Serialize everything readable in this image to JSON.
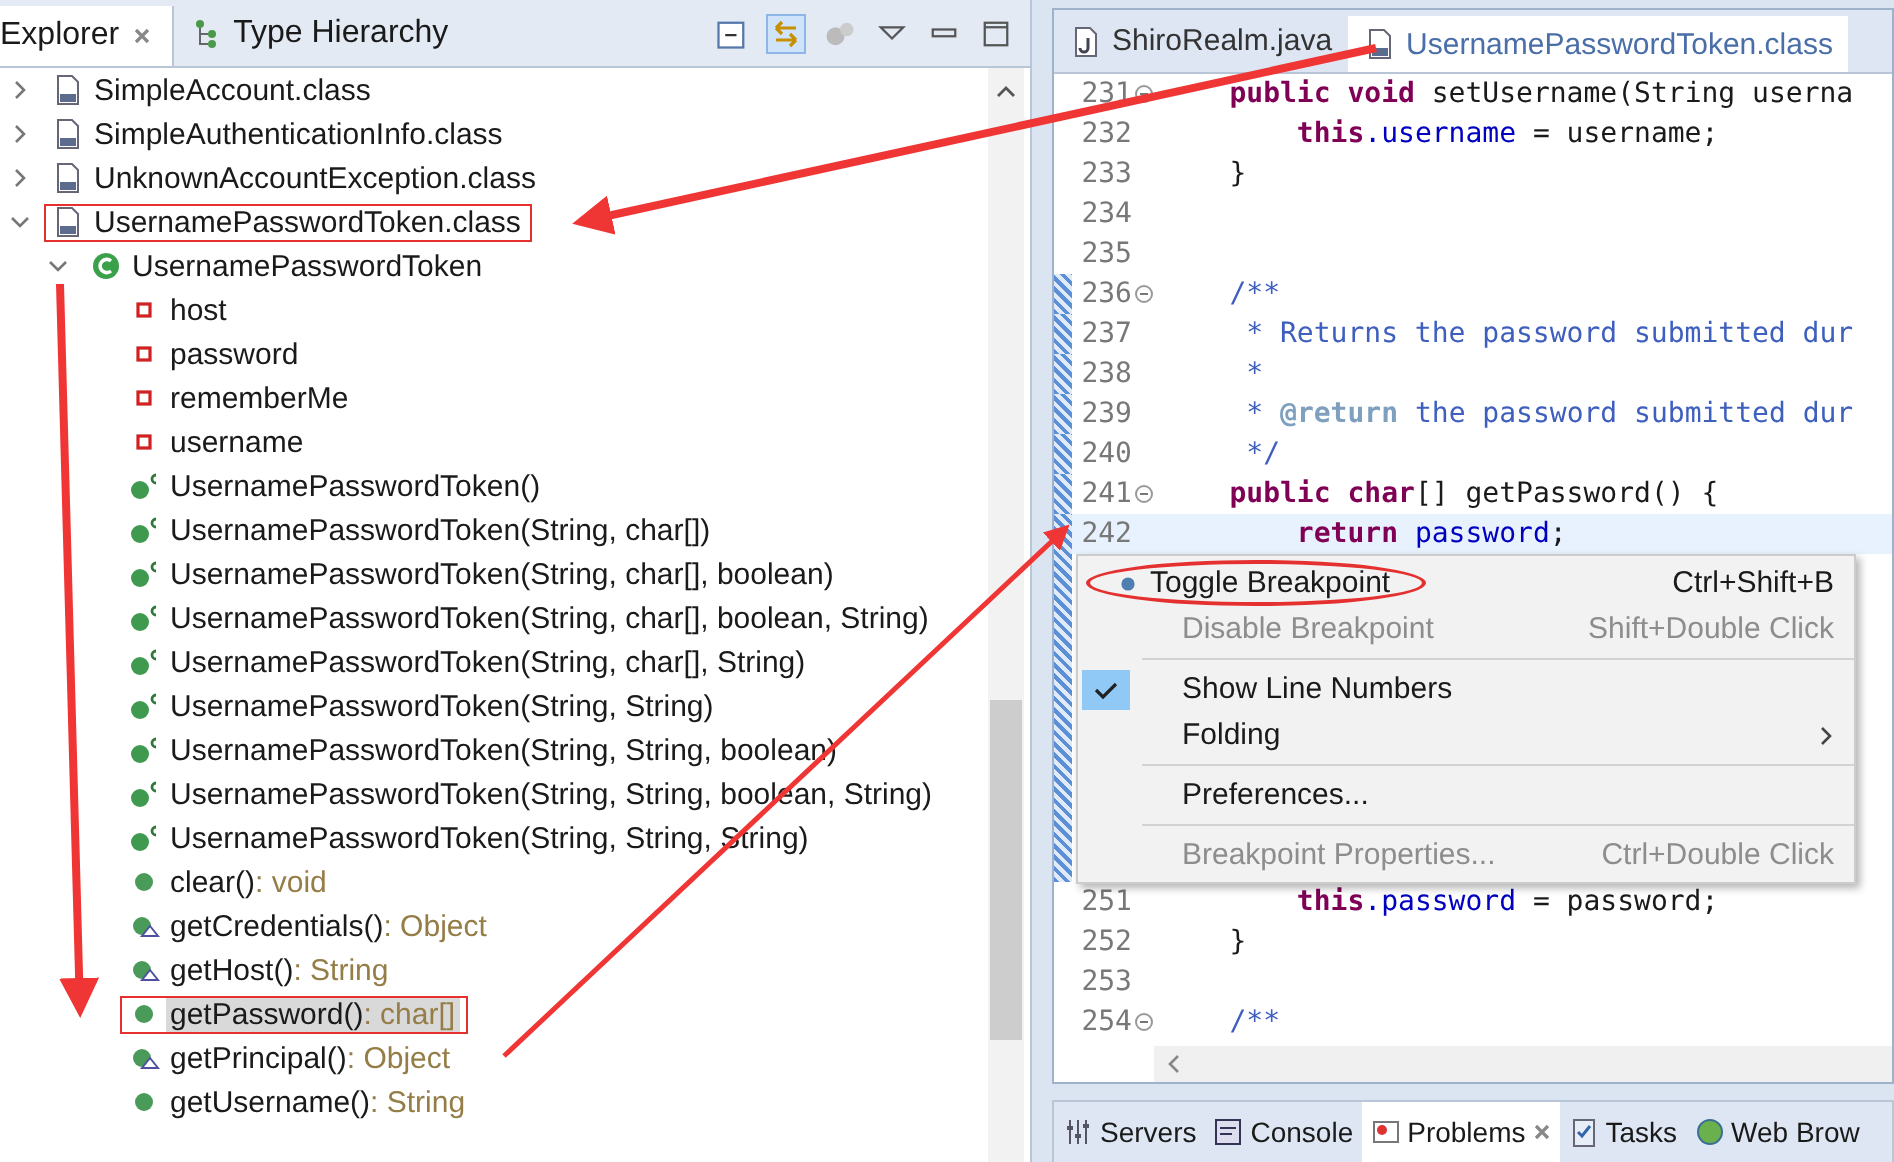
{
  "explorer": {
    "tabs": [
      {
        "label": "Explorer",
        "selected": true
      },
      {
        "label": "Type Hierarchy",
        "selected": false
      }
    ],
    "tree": [
      {
        "label": "SimpleAccount.class",
        "kind": "class-file",
        "expanded": false,
        "selected": false,
        "framed": false
      },
      {
        "label": "SimpleAuthenticationInfo.class",
        "kind": "class-file",
        "expanded": false,
        "selected": false,
        "framed": false
      },
      {
        "label": "UnknownAccountException.class",
        "kind": "class-file",
        "expanded": false,
        "selected": false,
        "framed": false
      },
      {
        "label": "UsernamePasswordToken.class",
        "kind": "class-file",
        "expanded": true,
        "selected": false,
        "framed": true,
        "children": [
          {
            "label": "UsernamePasswordToken",
            "kind": "class",
            "expanded": true,
            "selected": false,
            "framed": false,
            "children": [
              {
                "label": "host",
                "kind": "field",
                "selected": false,
                "framed": false
              },
              {
                "label": "password",
                "kind": "field",
                "selected": false,
                "framed": false
              },
              {
                "label": "rememberMe",
                "kind": "field",
                "selected": false,
                "framed": false
              },
              {
                "label": "username",
                "kind": "field",
                "selected": false,
                "framed": false
              },
              {
                "label": "UsernamePasswordToken()",
                "kind": "constructor",
                "selected": false,
                "framed": false
              },
              {
                "label": "UsernamePasswordToken(String, char[])",
                "kind": "constructor",
                "selected": false,
                "framed": false
              },
              {
                "label": "UsernamePasswordToken(String, char[], boolean)",
                "kind": "constructor",
                "selected": false,
                "framed": false
              },
              {
                "label": "UsernamePasswordToken(String, char[], boolean, String)",
                "kind": "constructor",
                "selected": false,
                "framed": false
              },
              {
                "label": "UsernamePasswordToken(String, char[], String)",
                "kind": "constructor",
                "selected": false,
                "framed": false
              },
              {
                "label": "UsernamePasswordToken(String, String)",
                "kind": "constructor",
                "selected": false,
                "framed": false
              },
              {
                "label": "UsernamePasswordToken(String, String, boolean)",
                "kind": "constructor",
                "selected": false,
                "framed": false
              },
              {
                "label": "UsernamePasswordToken(String, String, boolean, String)",
                "kind": "constructor",
                "selected": false,
                "framed": false
              },
              {
                "label": "UsernamePasswordToken(String, String, String)",
                "kind": "constructor",
                "selected": false,
                "framed": false
              },
              {
                "label": "clear()",
                "type": ": void",
                "kind": "method",
                "selected": false,
                "framed": false
              },
              {
                "label": "getCredentials()",
                "type": ": Object",
                "kind": "implemented-method",
                "selected": false,
                "framed": false
              },
              {
                "label": "getHost()",
                "type": ": String",
                "kind": "implemented-method",
                "selected": false,
                "framed": false
              },
              {
                "label": "getPassword()",
                "type": ": char[]",
                "kind": "method",
                "selected": true,
                "framed": true
              },
              {
                "label": "getPrincipal()",
                "type": ": Object",
                "kind": "implemented-method",
                "selected": false,
                "framed": false
              },
              {
                "label": "getUsername()",
                "type": ": String",
                "kind": "method",
                "selected": false,
                "framed": false
              }
            ]
          }
        ]
      }
    ]
  },
  "editor": {
    "tabs": [
      {
        "label": "ShiroRealm.java",
        "kind": "java",
        "selected": false
      },
      {
        "label": "UsernamePasswordToken.class",
        "kind": "class-file",
        "selected": true
      }
    ],
    "lines_above": [
      {
        "number": "231",
        "fold": true,
        "range": false,
        "current": false,
        "tokens": [
          {
            "kind": "keyword",
            "text": "    public"
          },
          {
            "kind": "keyword",
            "text": " void"
          },
          {
            "kind": "plain",
            "text": " setUsername(String userna"
          }
        ]
      },
      {
        "number": "232",
        "fold": false,
        "range": false,
        "current": false,
        "tokens": [
          {
            "kind": "keyword",
            "text": "        this"
          },
          {
            "kind": "field",
            "text": ".username"
          },
          {
            "kind": "plain",
            "text": " = username;"
          }
        ]
      },
      {
        "number": "233",
        "fold": false,
        "range": false,
        "current": false,
        "tokens": [
          {
            "kind": "plain",
            "text": "    }"
          }
        ]
      },
      {
        "number": "234",
        "fold": false,
        "range": false,
        "current": false
      },
      {
        "number": "235",
        "fold": false,
        "range": false,
        "current": false
      },
      {
        "number": "236",
        "fold": true,
        "range": true,
        "current": false,
        "tokens": [
          {
            "kind": "comment",
            "text": "    /**"
          }
        ]
      },
      {
        "number": "237",
        "fold": false,
        "range": true,
        "current": false,
        "tokens": [
          {
            "kind": "comment",
            "text": "     * Returns the password submitted dur"
          }
        ]
      },
      {
        "number": "238",
        "fold": false,
        "range": true,
        "current": false,
        "tokens": [
          {
            "kind": "comment",
            "text": "     *"
          }
        ]
      },
      {
        "number": "239",
        "fold": false,
        "range": true,
        "current": false,
        "tokens": [
          {
            "kind": "comment",
            "text": "     * "
          },
          {
            "kind": "doc-tag",
            "text": "@return"
          },
          {
            "kind": "comment",
            "text": " the password submitted dur"
          }
        ]
      },
      {
        "number": "240",
        "fold": false,
        "range": true,
        "current": false,
        "tokens": [
          {
            "kind": "comment",
            "text": "     */"
          }
        ]
      },
      {
        "number": "241",
        "fold": true,
        "range": true,
        "current": false,
        "tokens": [
          {
            "kind": "keyword",
            "text": "    public"
          },
          {
            "kind": "keyword",
            "text": " char"
          },
          {
            "kind": "plain",
            "text": "[] getPassword() {"
          }
        ]
      },
      {
        "number": "242",
        "fold": false,
        "range": true,
        "current": true,
        "tokens": [
          {
            "kind": "keyword",
            "text": "        return"
          },
          {
            "kind": "field",
            "text": " password"
          },
          {
            "kind": "plain",
            "text": ";"
          }
        ]
      }
    ],
    "context_menu": [
      {
        "kind": "item",
        "label": "Toggle Breakpoint",
        "shortcut": "Ctrl+Shift+B",
        "bullet": true,
        "checked": false,
        "disabled": false,
        "submenu": false,
        "circled": true
      },
      {
        "kind": "item",
        "label": "Disable Breakpoint",
        "shortcut": "Shift+Double Click",
        "bullet": false,
        "checked": false,
        "disabled": true,
        "submenu": false,
        "circled": false
      },
      {
        "kind": "separator"
      },
      {
        "kind": "item",
        "label": "Show Line Numbers",
        "bullet": false,
        "checked": true,
        "disabled": false,
        "submenu": false,
        "circled": false
      },
      {
        "kind": "item",
        "label": "Folding",
        "bullet": false,
        "checked": false,
        "disabled": false,
        "submenu": true,
        "circled": false
      },
      {
        "kind": "separator"
      },
      {
        "kind": "item",
        "label": "Preferences...",
        "bullet": false,
        "checked": false,
        "disabled": false,
        "submenu": false,
        "circled": false
      },
      {
        "kind": "separator"
      },
      {
        "kind": "item",
        "label": "Breakpoint Properties...",
        "shortcut": "Ctrl+Double Click",
        "bullet": false,
        "checked": false,
        "disabled": true,
        "submenu": false,
        "circled": false
      }
    ],
    "lines_below": [
      {
        "number": "251",
        "fold": false,
        "range": false,
        "current": false,
        "tokens": [
          {
            "kind": "keyword",
            "text": "        this"
          },
          {
            "kind": "field",
            "text": ".password"
          },
          {
            "kind": "plain",
            "text": " = password;"
          }
        ]
      },
      {
        "number": "252",
        "fold": false,
        "range": false,
        "current": false,
        "tokens": [
          {
            "kind": "plain",
            "text": "    }"
          }
        ]
      },
      {
        "number": "253",
        "fold": false,
        "range": false,
        "current": false
      },
      {
        "number": "254",
        "fold": true,
        "range": false,
        "current": false,
        "tokens": [
          {
            "kind": "comment",
            "text": "    /**"
          }
        ]
      }
    ]
  },
  "bottom_tabs": [
    {
      "label": "Servers",
      "kind": "servers",
      "selected": false
    },
    {
      "label": "Console",
      "kind": "console",
      "selected": false
    },
    {
      "label": "Problems",
      "kind": "problems",
      "selected": true
    },
    {
      "label": "Tasks",
      "kind": "tasks",
      "selected": false
    },
    {
      "label": "Web Brow",
      "kind": "browser",
      "selected": false
    }
  ]
}
